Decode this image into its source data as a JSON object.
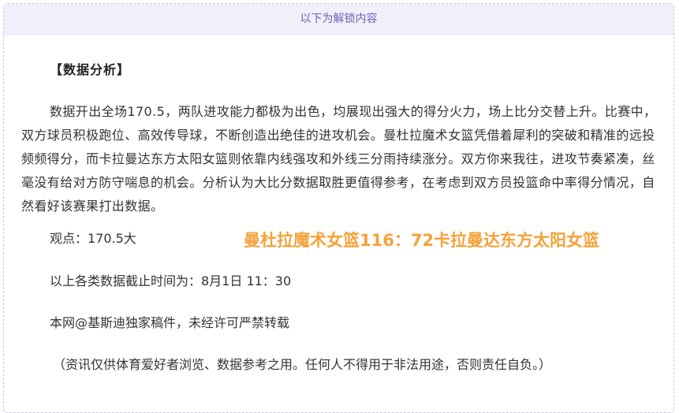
{
  "header": {
    "unlock_text": "以下为解锁内容"
  },
  "article": {
    "heading": "【数据分析】",
    "paragraph": "数据开出全场170.5，两队进攻能力都极为出色，均展现出强大的得分火力，场上比分交替上升。比赛中，双方球员积极跑位、高效传导球，不断创造出绝佳的进攻机会。曼杜拉魔术女篮凭借着犀利的突破和精准的远投频频得分，而卡拉曼达东方太阳女篮则依靠内线强攻和外线三分雨持续涨分。双方你来我往，进攻节奏紧凑，丝毫没有给对方防守喘息的机会。分析认为大比分数据取胜更值得参考，在考虑到双方员投篮命中率得分情况，自然看好该赛果打出数据。",
    "viewpoint": "观点：170.5大",
    "score_watermark": "曼杜拉魔术女篮116：72卡拉曼达东方太阳女篮",
    "deadline": "以上各类数据截止时间为：8月1日 11：30",
    "copyright": "本网@基斯迪独家稿件，未经许可严禁转载",
    "disclaimer": "（资讯仅供体育爱好者浏览、数据参考之用。任何人不得用于非法用途，否则责任自负。）"
  },
  "colors": {
    "accent": "#6b63b5",
    "score": "#f5a23a"
  }
}
